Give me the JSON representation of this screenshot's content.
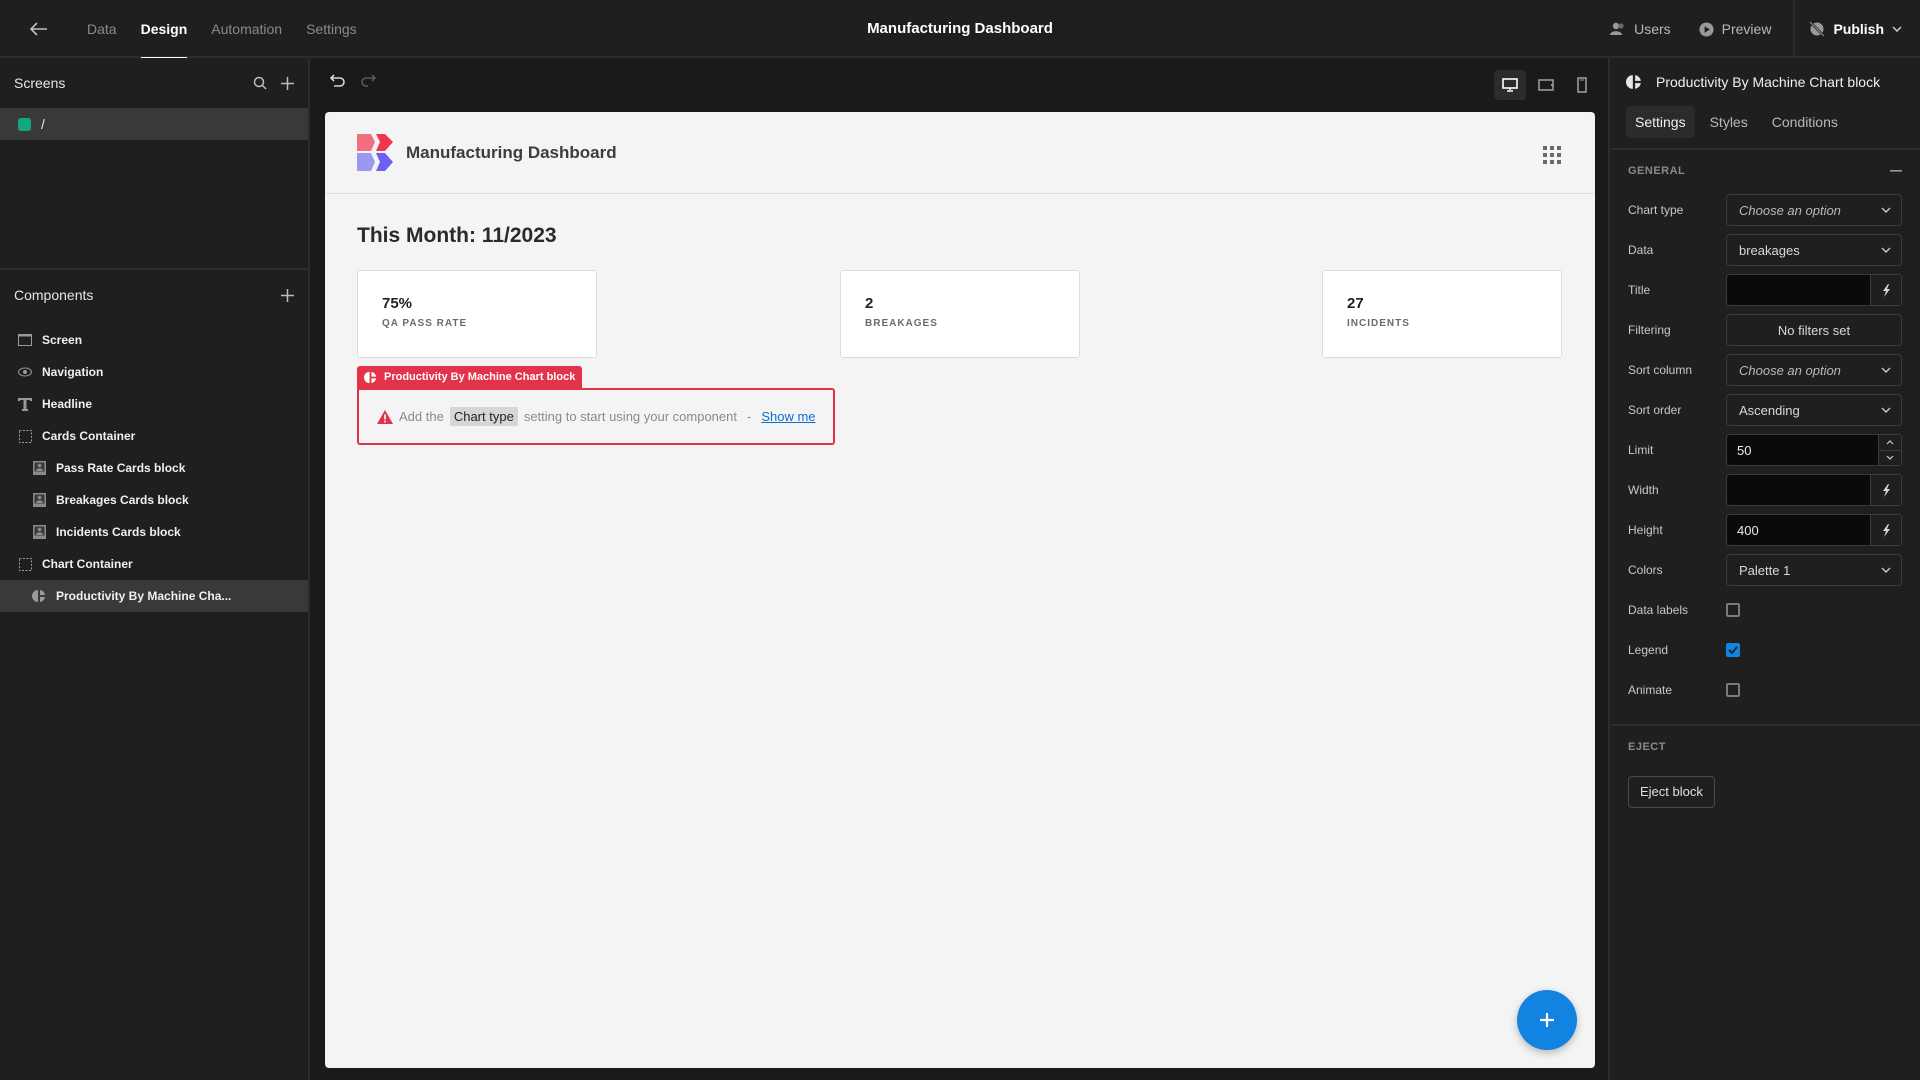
{
  "topbar": {
    "tabs": [
      {
        "label": "Data",
        "active": false
      },
      {
        "label": "Design",
        "active": true
      },
      {
        "label": "Automation",
        "active": false
      },
      {
        "label": "Settings",
        "active": false
      }
    ],
    "app_title": "Manufacturing Dashboard",
    "users_label": "Users",
    "preview_label": "Preview",
    "publish_label": "Publish"
  },
  "screens": {
    "title": "Screens",
    "items": [
      {
        "route": "/",
        "color": "#13a77e"
      }
    ]
  },
  "components": {
    "title": "Components",
    "items": [
      {
        "label": "Screen",
        "icon": "screen-icon",
        "level": 1
      },
      {
        "label": "Navigation",
        "icon": "eye-icon",
        "level": 1
      },
      {
        "label": "Headline",
        "icon": "text-icon",
        "level": 1
      },
      {
        "label": "Cards Container",
        "icon": "container-icon",
        "level": 1
      },
      {
        "label": "Pass Rate Cards block",
        "icon": "card-icon",
        "level": 2
      },
      {
        "label": "Breakages Cards block",
        "icon": "card-icon",
        "level": 2
      },
      {
        "label": "Incidents Cards block",
        "icon": "card-icon",
        "level": 2
      },
      {
        "label": "Chart Container",
        "icon": "container-icon",
        "level": 1
      },
      {
        "label": "Productivity By Machine Cha...",
        "icon": "chart-icon",
        "level": 2,
        "selected": true
      }
    ]
  },
  "preview": {
    "app_title": "Manufacturing Dashboard",
    "headline": "This Month: 11/2023",
    "cards": [
      {
        "value": "75%",
        "label": "QA PASS RATE"
      },
      {
        "value": "2",
        "label": "BREAKAGES"
      },
      {
        "value": "27",
        "label": "INCIDENTS"
      }
    ],
    "chart_block": {
      "tag": "Productivity By Machine Chart block",
      "msg_prefix": "Add the",
      "msg_highlight": "Chart type",
      "msg_suffix": "setting to start using your component",
      "separator": "-",
      "link": "Show me"
    }
  },
  "settings": {
    "component_title": "Productivity By Machine Chart block",
    "tabs": [
      {
        "label": "Settings",
        "active": true
      },
      {
        "label": "Styles",
        "active": false
      },
      {
        "label": "Conditions",
        "active": false
      }
    ],
    "general_title": "GENERAL",
    "fields": {
      "chart_type": {
        "label": "Chart type",
        "placeholder": "Choose an option"
      },
      "data": {
        "label": "Data",
        "value": "breakages"
      },
      "title": {
        "label": "Title",
        "value": ""
      },
      "filtering": {
        "label": "Filtering",
        "value": "No filters set"
      },
      "sort_column": {
        "label": "Sort column",
        "placeholder": "Choose an option"
      },
      "sort_order": {
        "label": "Sort order",
        "value": "Ascending"
      },
      "limit": {
        "label": "Limit",
        "value": "50"
      },
      "width": {
        "label": "Width",
        "value": ""
      },
      "height": {
        "label": "Height",
        "value": "400"
      },
      "colors": {
        "label": "Colors",
        "value": "Palette 1"
      },
      "data_labels": {
        "label": "Data labels",
        "checked": false
      },
      "legend": {
        "label": "Legend",
        "checked": true
      },
      "animate": {
        "label": "Animate",
        "checked": false
      }
    },
    "eject_title": "EJECT",
    "eject_button": "Eject block"
  }
}
